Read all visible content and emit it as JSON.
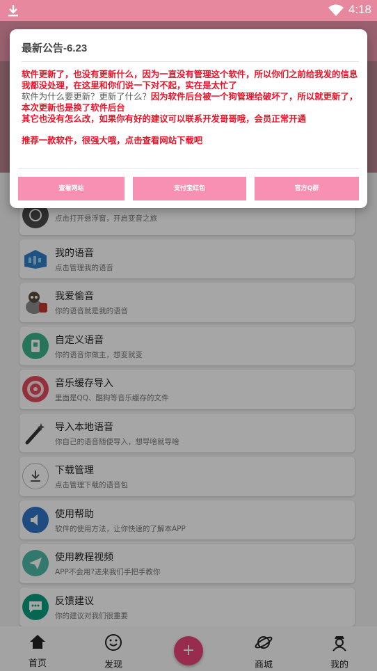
{
  "statusbar": {
    "time": "4:18"
  },
  "list": [
    {
      "title": "",
      "sub": "点击打开悬浮窗，开启变音之旅",
      "icon": "floating-window-icon"
    },
    {
      "title": "我的语音",
      "sub": "点击管理我的语音",
      "icon": "voice-folder-icon"
    },
    {
      "title": "我爱偷音",
      "sub": "你的语音就是我的语音",
      "icon": "thief-icon"
    },
    {
      "title": "自定义语音",
      "sub": "你的语音你做主，想变就变",
      "icon": "custom-voice-icon"
    },
    {
      "title": "音乐缓存导入",
      "sub": "里面是QQ、酷狗等音乐缓存的文件",
      "icon": "music-disc-icon"
    },
    {
      "title": "导入本地语音",
      "sub": "你自己的语音随便导入，想导啥就导啥",
      "icon": "magic-wand-icon"
    },
    {
      "title": "下载管理",
      "sub": "点击管理下载的语音包",
      "icon": "download-icon"
    },
    {
      "title": "使用帮助",
      "sub": "软件的使用方法，让你快速的了解本APP",
      "icon": "help-speaker-icon"
    },
    {
      "title": "使用教程视频",
      "sub": "APP不会用?进来我们手把手教你",
      "icon": "paper-plane-icon"
    },
    {
      "title": "反馈建议",
      "sub": "你的建议对我们很重要",
      "icon": "feedback-chat-icon"
    }
  ],
  "tabbar": {
    "home": "首页",
    "discover": "发现",
    "add": "+",
    "mall": "商城",
    "mine": "我的"
  },
  "dialog": {
    "title": "最新公告-6.23",
    "line1": "软件更新了，也没有更新什么，因为一直没有管理这个软件，所以你们之前给我发的信息我都没处理，在这里和你们说一下对不起，实在是太忙了",
    "q2": "软件为什么要更新？更新了什么？",
    "a2": "因为软件后台被一个狗管理给破坏了，所以就更新了，本次更新也是换了软件后台",
    "line3": "其它也没有怎么改，如果你有好的建议可以联系开发哥哥哦，会员正常开通",
    "line4": "推荐一款软件，很强大哦，点击查看网站下载吧",
    "btn_website": "查看网站",
    "btn_alipay": "支付宝红包",
    "btn_qq": "官方Q群"
  },
  "colors": {
    "statusbar": "#e7889e",
    "appbar": "#ec96ac",
    "dialog_text_red": "#e8142a",
    "dialog_button": "#f790b3",
    "fab": "#e9447a"
  }
}
